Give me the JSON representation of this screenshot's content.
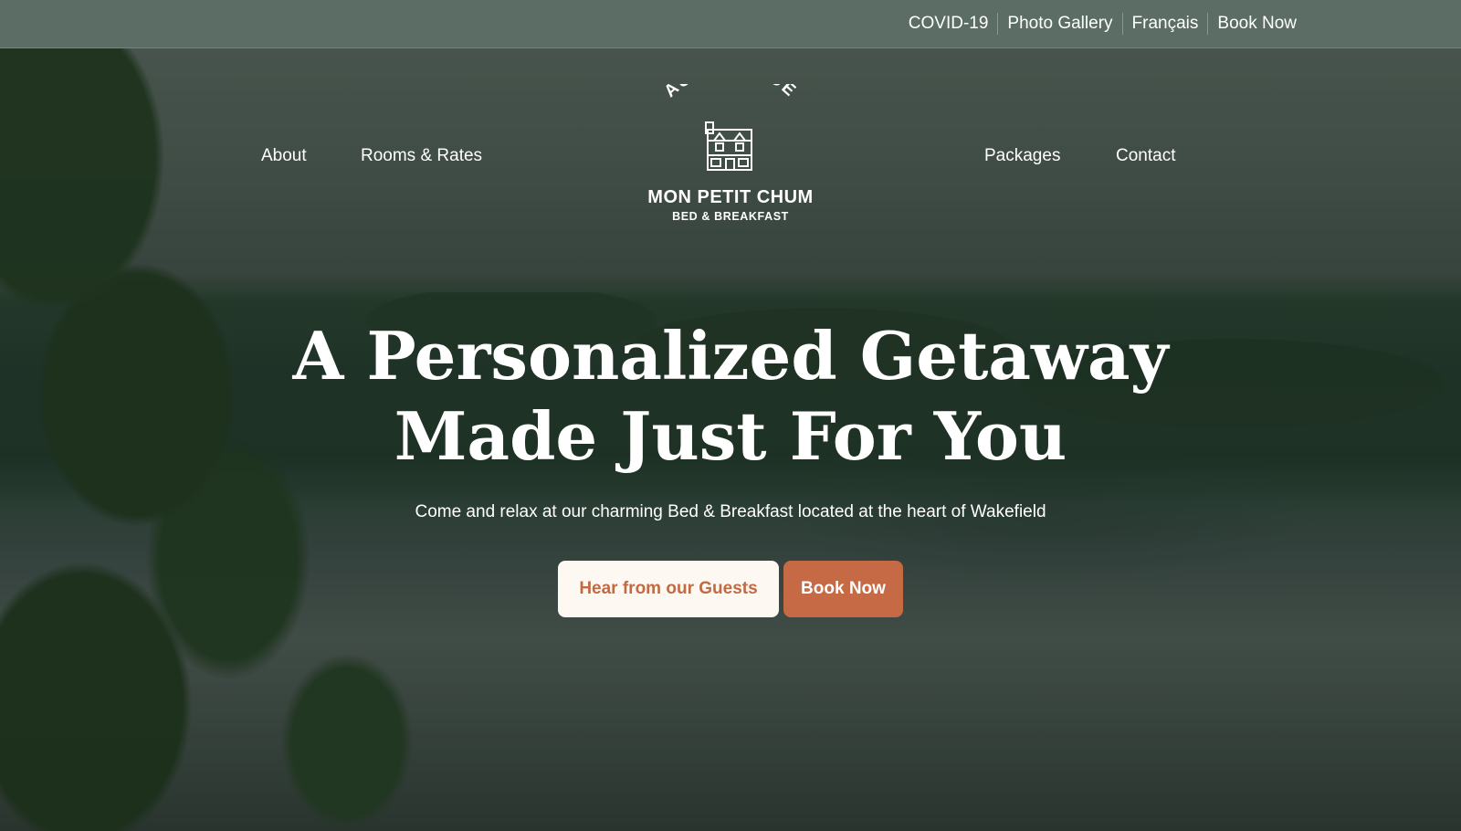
{
  "topbar": {
    "links": [
      "COVID-19",
      "Photo Gallery",
      "Français",
      "Book Now"
    ]
  },
  "nav": {
    "left": [
      "About",
      "Rooms & Rates"
    ],
    "right": [
      "Packages",
      "Contact"
    ]
  },
  "logo": {
    "arc_text": "AUBERGE DE",
    "name": "MON PETIT CHUM",
    "subtitle": "BED & BREAKFAST",
    "icon": "house-icon"
  },
  "hero": {
    "title_line1": "A Personalized Getaway",
    "title_line2": "Made Just For You",
    "subtitle": "Come and relax at our charming Bed & Breakfast located at the heart of Wakefield"
  },
  "buttons": {
    "guests": "Hear from our Guests",
    "book": "Book Now"
  },
  "colors": {
    "topbar": "#5b6d64",
    "accent": "#c56a45",
    "button_light": "#fdf8f1"
  }
}
